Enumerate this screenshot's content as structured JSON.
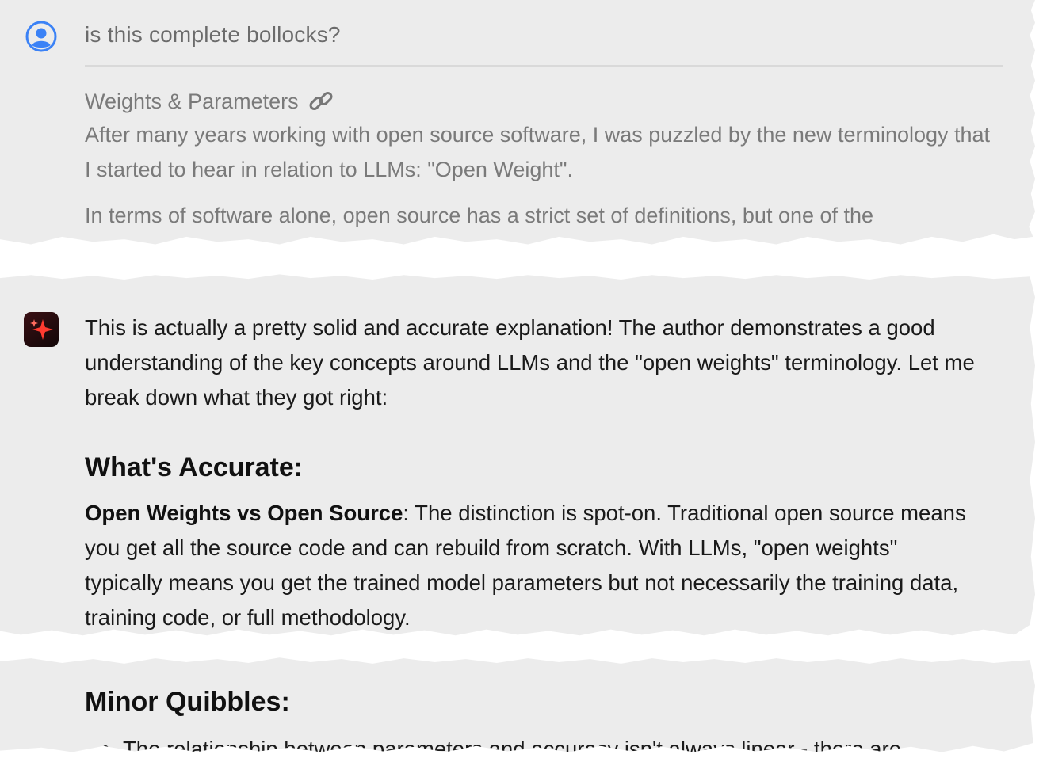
{
  "user_message": {
    "text": "is this complete bollocks?",
    "quote_title": "Weights & Parameters",
    "quote_paragraph_1": "After many years working with open source software, I was puzzled by the new terminology that I started to hear in relation to LLMs: \"Open Weight\".",
    "quote_paragraph_2": "In terms of software alone, open source has a strict set of definitions, but one of the"
  },
  "assistant_message": {
    "intro": "This is actually a pretty solid and accurate explanation! The author demonstrates a good understanding of the key concepts around LLMs and the \"open weights\" terminology. Let me break down what they got right:",
    "heading_accurate": "What's Accurate:",
    "point_1_bold": "Open Weights vs Open Source",
    "point_1_text": ": The distinction is spot-on. Traditional open source means you get all the source code and can rebuild from scratch. With LLMs, \"open weights\" typically means you get the trained model parameters but not necessarily the training data, training code, or full methodology.",
    "heading_quibbles": "Minor Quibbles:",
    "bullet_1": "The relationship between parameters and accuracy isn't always linear - there are"
  },
  "icons": {
    "user": "user-circle-icon",
    "link": "link-icon",
    "assistant": "sparkle-icon"
  },
  "colors": {
    "paper": "#ececec",
    "user_icon": "#3b82f6",
    "muted_text": "#7a7a7a",
    "body_text": "#1a1a1a",
    "sparkle": "#ff3b30"
  }
}
